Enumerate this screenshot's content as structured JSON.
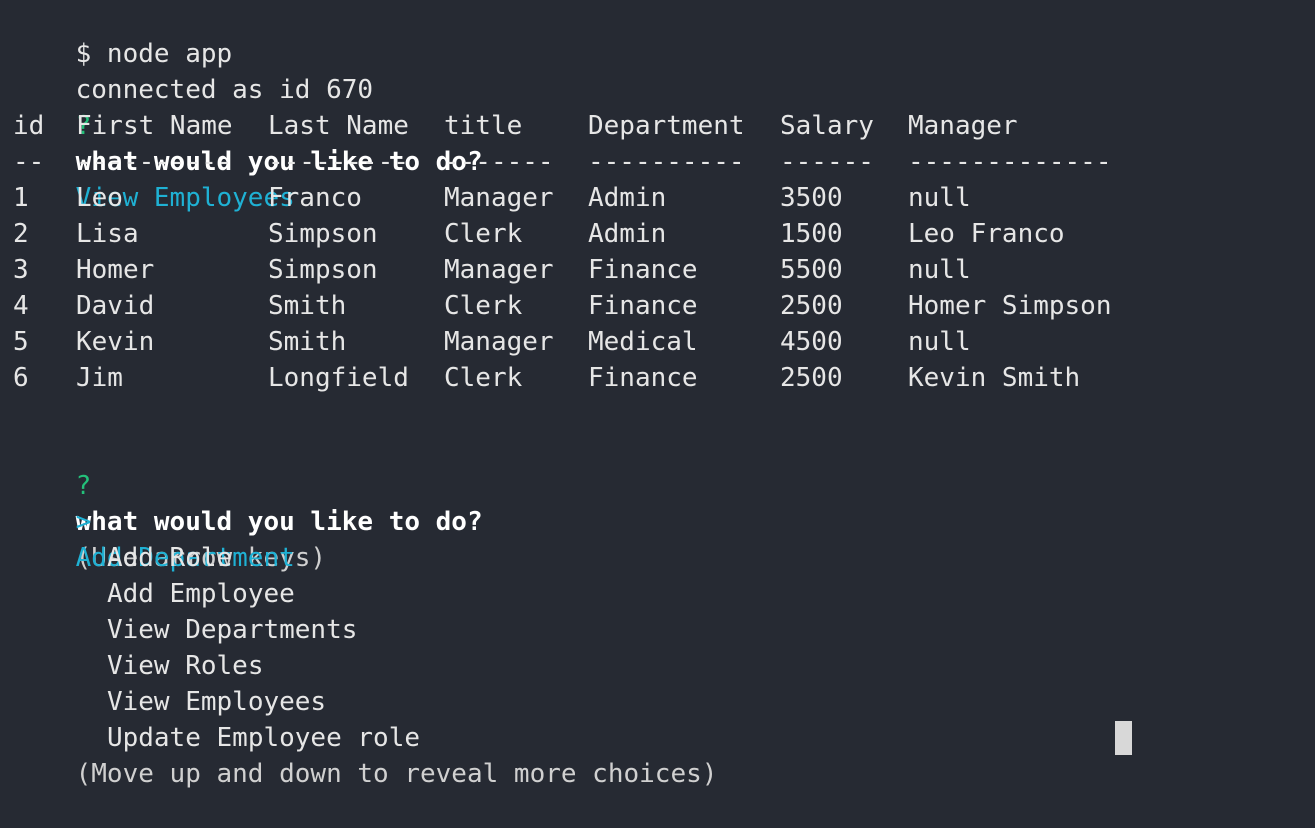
{
  "terminal": {
    "command": "$ node app",
    "connected": "connected as id 670"
  },
  "prompt1": {
    "mark": "?",
    "question": "what would you like to do?",
    "answer": "View Employees"
  },
  "table": {
    "headers": [
      "id",
      "First Name",
      "Last Name",
      "title",
      "Department",
      "Salary",
      "Manager"
    ],
    "separators": [
      "--",
      "----------",
      "---------",
      "-------",
      "----------",
      "------",
      "-------------"
    ],
    "rows": [
      [
        "1",
        "Leo",
        "Franco",
        "Manager",
        "Admin",
        "3500",
        "null"
      ],
      [
        "2",
        "Lisa",
        "Simpson",
        "Clerk",
        "Admin",
        "1500",
        "Leo Franco"
      ],
      [
        "3",
        "Homer",
        "Simpson",
        "Manager",
        "Finance",
        "5500",
        "null"
      ],
      [
        "4",
        "David",
        "Smith",
        "Clerk",
        "Finance",
        "2500",
        "Homer Simpson"
      ],
      [
        "5",
        "Kevin",
        "Smith",
        "Manager",
        "Medical",
        "4500",
        "null"
      ],
      [
        "6",
        "Jim",
        "Longfield",
        "Clerk",
        "Finance",
        "2500",
        "Kevin Smith"
      ]
    ]
  },
  "prompt2": {
    "mark": "?",
    "question": "what would you like to do?",
    "hint": "(Use arrow keys)",
    "pointer": ">",
    "choices": [
      "Add Department",
      "Add Role",
      "Add Employee",
      "View Departments",
      "View Roles",
      "View Employees",
      "Update Employee role"
    ],
    "footer": "(Move up and down to reveal more choices)"
  }
}
